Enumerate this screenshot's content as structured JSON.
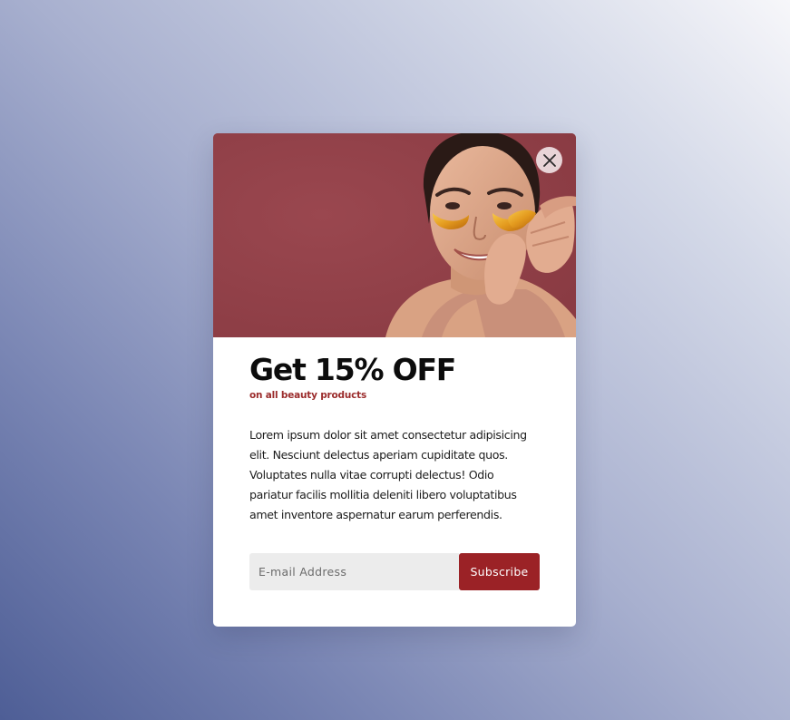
{
  "popup": {
    "title": "Get 15% OFF",
    "subtitle": "on all beauty products",
    "body": "Lorem ipsum dolor sit amet consectetur adipisicing elit. Nesciunt delectus aperiam cupiditate quos. Voluptates nulla vitae corrupti delectus! Odio pariatur facilis mollitia deleniti libero voluptatibus amet inventore aspernatur earum perferendis.",
    "email_placeholder": "E-mail Address",
    "email_value": "",
    "subscribe_label": "Subscribe"
  },
  "icons": {
    "close": "close-icon",
    "hero": "hero-image"
  },
  "colors": {
    "accent": "#9b2226",
    "subtitle": "#9b2c2c",
    "hero_background": "#93424a",
    "input_background": "#ececec"
  }
}
